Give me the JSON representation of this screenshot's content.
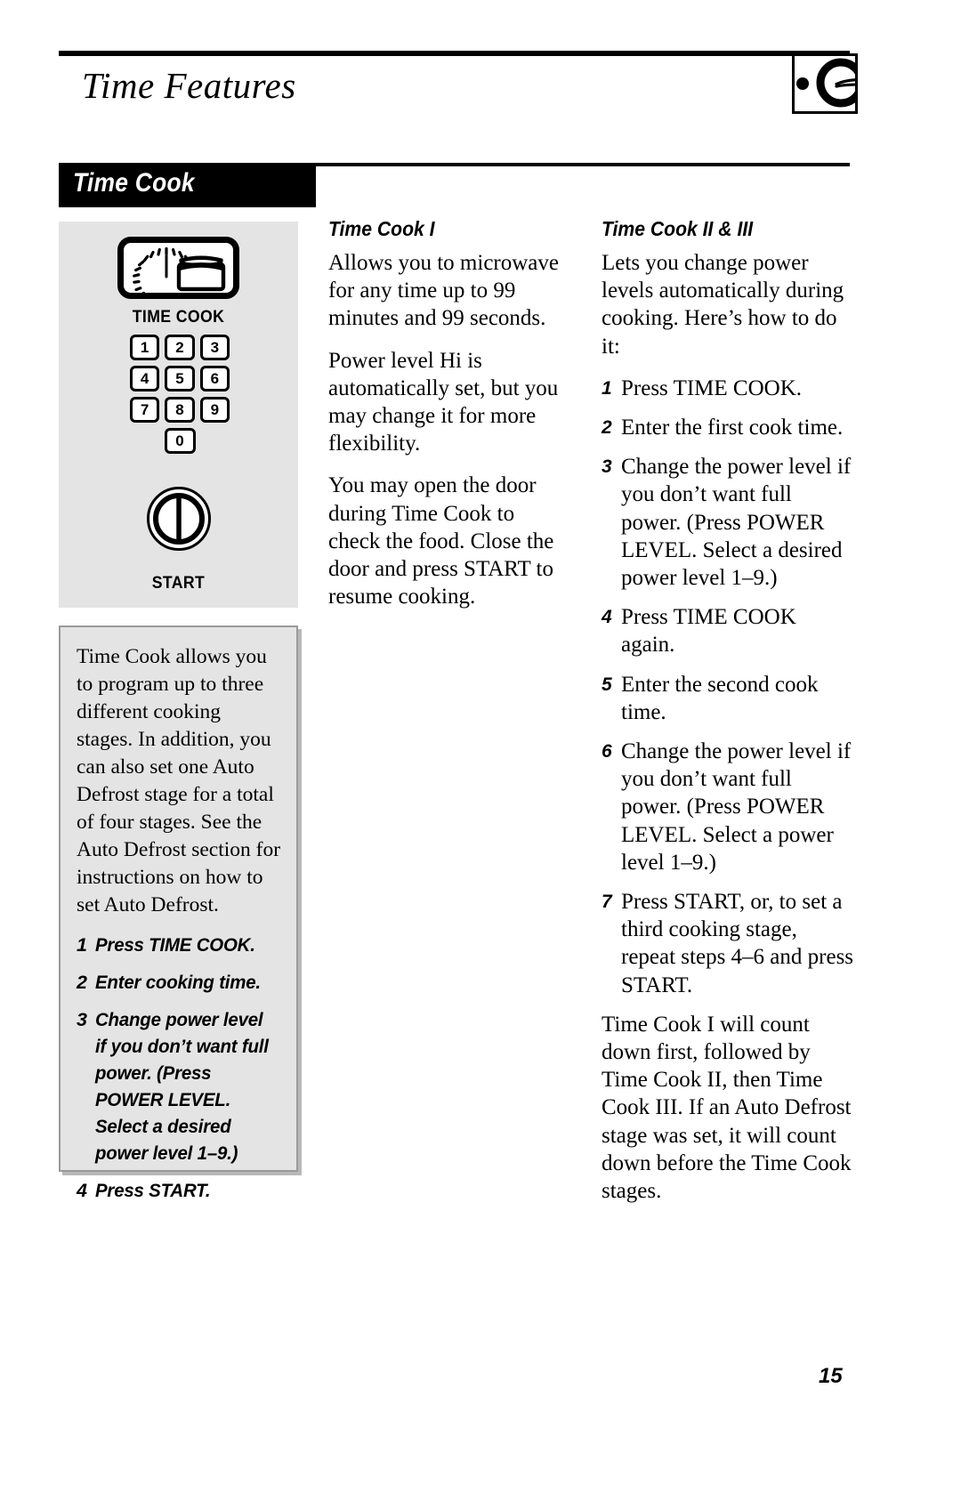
{
  "header": {
    "title": "Time Features",
    "logo_icon": "ge-monogram-logo"
  },
  "section": {
    "title": "Time Cook"
  },
  "control_panel": {
    "time_cook_button_icon": "timer-and-food-container-icon",
    "time_cook_label": "TIME COOK",
    "keypad_rows": [
      [
        "1",
        "2",
        "3"
      ],
      [
        "4",
        "5",
        "6"
      ],
      [
        "7",
        "8",
        "9"
      ],
      [
        "0"
      ]
    ],
    "start_button_icon": "start-power-knob-icon",
    "start_label": "START"
  },
  "info_box": {
    "paragraph": "Time Cook allows you to program up to three different cooking stages. In addition, you can also set one Auto Defrost stage for a total of four stages. See the Auto Defrost section for instructions on how to set Auto Defrost.",
    "steps": [
      {
        "num": "1",
        "text": "Press TIME COOK."
      },
      {
        "num": "2",
        "text": "Enter cooking time."
      },
      {
        "num": "3",
        "text": "Change power level if you don’t want full power. (Press POWER LEVEL. Select a desired power level 1–9.)"
      },
      {
        "num": "4",
        "text": "Press START."
      }
    ]
  },
  "column_mid": {
    "heading": "Time Cook I",
    "paragraphs": [
      "Allows you to microwave for any time up to 99 minutes and 99 seconds.",
      "Power level Hi is automatically set, but you may change it for more flexibility.",
      "You may open the door during Time Cook to check the food. Close the door and press START to resume cooking."
    ]
  },
  "column_right": {
    "heading": "Time Cook II & III",
    "intro": "Lets you change power levels automatically during cooking. Here’s how to do it:",
    "steps": [
      {
        "num": "1",
        "text": "Press TIME COOK."
      },
      {
        "num": "2",
        "text": "Enter the first cook time."
      },
      {
        "num": "3",
        "text": "Change the power level if you don’t want full power. (Press POWER LEVEL. Select a desired power level 1–9.)"
      },
      {
        "num": "4",
        "text": "Press TIME COOK again."
      },
      {
        "num": "5",
        "text": "Enter the second cook time."
      },
      {
        "num": "6",
        "text": "Change the power level if you don’t want full power. (Press POWER LEVEL. Select a power level 1–9.)"
      },
      {
        "num": "7",
        "text": "Press START, or, to set a third cooking stage, repeat steps 4–6 and press START."
      }
    ],
    "closing": "Time Cook I will count down first, followed by Time Cook II, then Time Cook III. If an Auto Defrost stage was set, it will count down before the Time Cook stages."
  },
  "footer": {
    "page_number": "15"
  }
}
